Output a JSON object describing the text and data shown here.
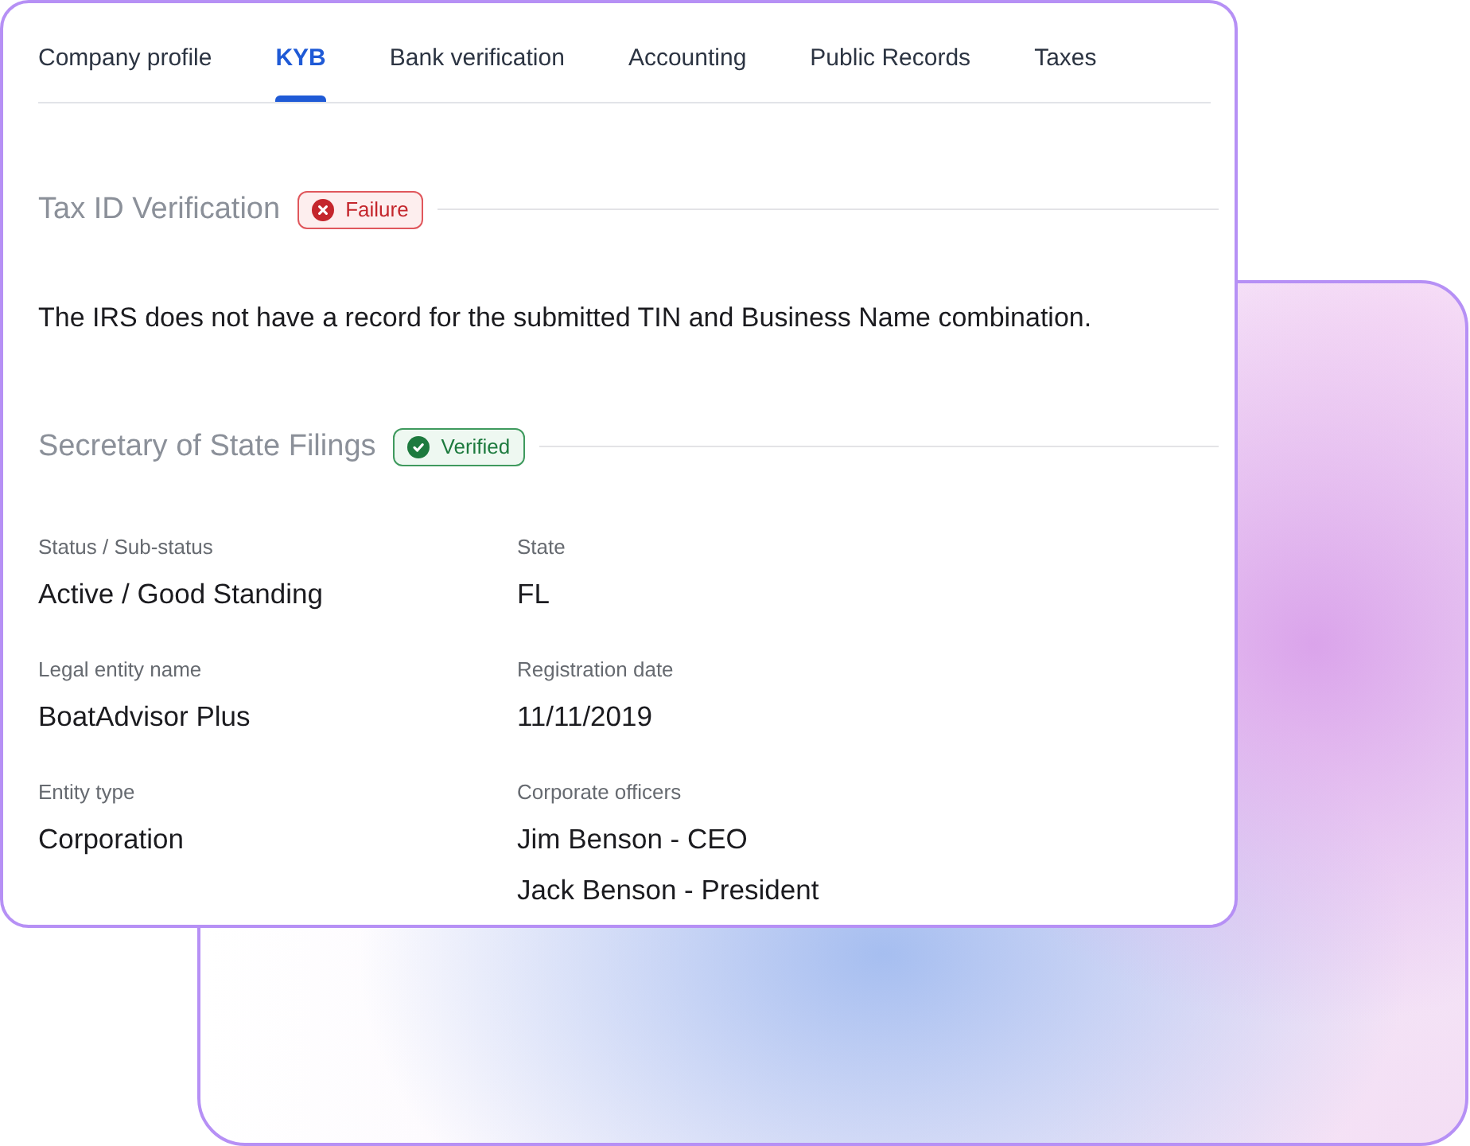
{
  "tabs": [
    {
      "label": "Company profile",
      "selected": false
    },
    {
      "label": "KYB",
      "selected": true
    },
    {
      "label": "Bank verification",
      "selected": false
    },
    {
      "label": "Accounting",
      "selected": false
    },
    {
      "label": "Public Records",
      "selected": false
    },
    {
      "label": "Taxes",
      "selected": false
    }
  ],
  "sections": [
    {
      "title": "Tax ID Verification",
      "status": {
        "kind": "failure",
        "label": "Failure"
      },
      "message": "The IRS does not have a record for the submitted TIN and Business Name combination."
    },
    {
      "title": "Secretary of State Filings",
      "status": {
        "kind": "verified",
        "label": "Verified"
      },
      "fields": [
        {
          "label": "Status / Sub-status",
          "values": [
            "Active / Good Standing"
          ]
        },
        {
          "label": "State",
          "values": [
            "FL"
          ]
        },
        {
          "label": "Legal entity name",
          "values": [
            "BoatAdvisor Plus"
          ]
        },
        {
          "label": "Registration date",
          "values": [
            "11/11/2019"
          ]
        },
        {
          "label": "Entity type",
          "values": [
            "Corporation"
          ]
        },
        {
          "label": "Corporate officers",
          "values": [
            "Jim Benson - CEO",
            "Jack Benson - President"
          ]
        }
      ]
    }
  ]
}
